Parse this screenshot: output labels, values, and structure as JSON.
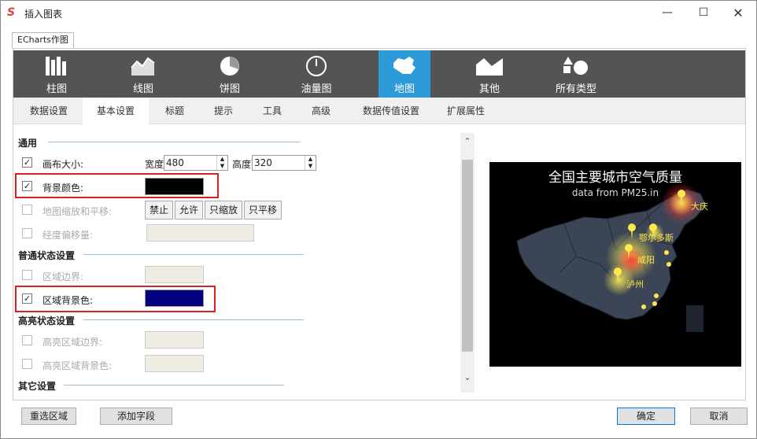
{
  "window": {
    "title": "插入图表",
    "app_icon": "S"
  },
  "tabs": {
    "echarts": "ECharts作图"
  },
  "chart_types": [
    {
      "label": "柱图",
      "icon": "bar-chart-icon"
    },
    {
      "label": "线图",
      "icon": "line-chart-icon"
    },
    {
      "label": "饼图",
      "icon": "pie-chart-icon"
    },
    {
      "label": "油量图",
      "icon": "gauge-icon"
    },
    {
      "label": "地图",
      "icon": "map-icon",
      "active": true
    },
    {
      "label": "其他",
      "icon": "other-icon"
    },
    {
      "label": "所有类型",
      "icon": "shapes-icon"
    }
  ],
  "sub_tabs": [
    "数据设置",
    "基本设置",
    "标题",
    "提示",
    "工具",
    "高级",
    "数据传值设置",
    "扩展属性"
  ],
  "sections": {
    "general": "通用",
    "normal": "普通状态设置",
    "highlight": "高亮状态设置",
    "other": "其它设置"
  },
  "rows": {
    "canvas_size": "画布大小:",
    "width_label": "宽度",
    "width_value": "480",
    "height_label": "高度",
    "height_value": "320",
    "bg_color": "背景颜色:",
    "zoom_pan": "地图缩放和平移:",
    "zoom_opts": [
      "禁止",
      "允许",
      "只缩放",
      "只平移"
    ],
    "longitude_offset": "经度偏移量:",
    "region_border": "区域边界:",
    "region_bg": "区域背景色:",
    "hl_border": "高亮区域边界:",
    "hl_bg": "高亮区域背景色:"
  },
  "colors": {
    "bg_color": "#000000",
    "region_bg": "#000080",
    "active_tab": "#2b9ad6"
  },
  "preview": {
    "title": "全国主要城市空气质量",
    "subtitle": "data from PM25.in",
    "labels": [
      "大庆",
      "鄂尔多斯",
      "咸阳",
      "泸州"
    ]
  },
  "buttons": {
    "reselect": "重选区域",
    "add_field": "添加字段",
    "ok": "确定",
    "cancel": "取消"
  }
}
